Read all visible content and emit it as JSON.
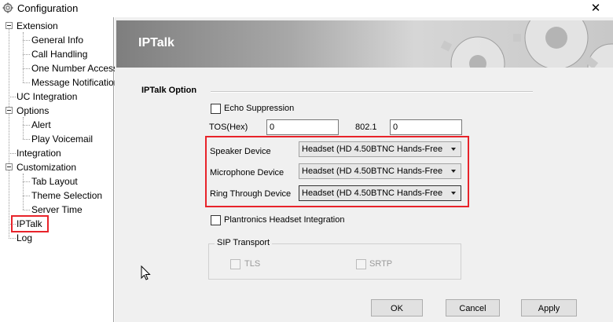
{
  "window": {
    "title": "Configuration",
    "close_glyph": "✕"
  },
  "tree": {
    "items": [
      {
        "label": "Extension"
      },
      {
        "label": "General Info"
      },
      {
        "label": "Call Handling"
      },
      {
        "label": "One Number Access"
      },
      {
        "label": "Message Notification"
      },
      {
        "label": "UC Integration"
      },
      {
        "label": "Options"
      },
      {
        "label": "Alert"
      },
      {
        "label": "Play Voicemail"
      },
      {
        "label": "Integration"
      },
      {
        "label": "Customization"
      },
      {
        "label": "Tab Layout"
      },
      {
        "label": "Theme Selection"
      },
      {
        "label": "Server Time"
      },
      {
        "label": "IPTalk"
      },
      {
        "label": "Log"
      }
    ]
  },
  "banner": {
    "title": "IPTalk"
  },
  "iptalk": {
    "group_title": "IPTalk Option",
    "echo_suppression": {
      "label": "Echo Suppression",
      "checked": false
    },
    "tos": {
      "label": "TOS(Hex)",
      "value": "0"
    },
    "dot1": {
      "label": "802.1",
      "value": "0"
    },
    "speaker": {
      "label": "Speaker Device",
      "value": "Headset (HD 4.50BTNC Hands-Free"
    },
    "microphone": {
      "label": "Microphone Device",
      "value": "Headset (HD 4.50BTNC Hands-Free"
    },
    "ring": {
      "label": "Ring Through Device",
      "value": "Headset (HD 4.50BTNC Hands-Free"
    },
    "plantronics": {
      "label": "Plantronics Headset Integration",
      "checked": false
    }
  },
  "sip": {
    "title": "SIP Transport",
    "tls": {
      "label": "TLS",
      "checked": false
    },
    "srtp": {
      "label": "SRTP",
      "checked": false
    }
  },
  "buttons": {
    "ok": "OK",
    "cancel": "Cancel",
    "apply": "Apply"
  },
  "colors": {
    "highlight": "#e8232a",
    "panel": "#f0f0f0"
  }
}
